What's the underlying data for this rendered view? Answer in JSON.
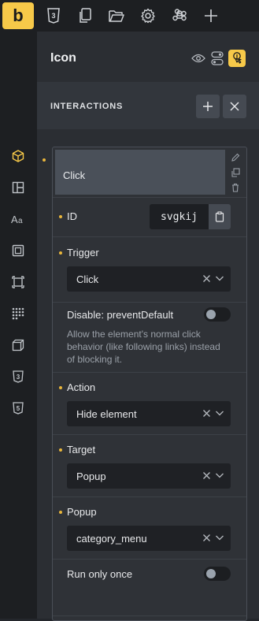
{
  "toolbar": {
    "logo": "b",
    "icons": [
      "css3-icon",
      "pages-icon",
      "folder-icon",
      "settings-icon",
      "command-icon",
      "add-icon"
    ]
  },
  "sidebar": {
    "icons": [
      "cube-icon",
      "layout-icon",
      "typography-icon",
      "spacing-icon",
      "border-icon",
      "grid-icon",
      "transform-icon",
      "css3-icon",
      "html5-icon"
    ]
  },
  "panel": {
    "title": "Icon",
    "section_title": "INTERACTIONS"
  },
  "interaction": {
    "header": "Click",
    "id_label": "ID",
    "id_value": "svgkij",
    "trigger_label": "Trigger",
    "trigger_value": "Click",
    "disable_label": "Disable: preventDefault",
    "disable_desc": "Allow the element's normal click behavior (like following links) instead of blocking it.",
    "disable_on": false,
    "action_label": "Action",
    "action_value": "Hide element",
    "target_label": "Target",
    "target_value": "Popup",
    "popup_label": "Popup",
    "popup_value": "category_menu",
    "run_once_label": "Run only once",
    "run_once_on": false
  },
  "colors": {
    "accent": "#f7c949",
    "dot": "#e9b63b",
    "rail": "#1d1f22",
    "panel": "#2b2e33"
  }
}
